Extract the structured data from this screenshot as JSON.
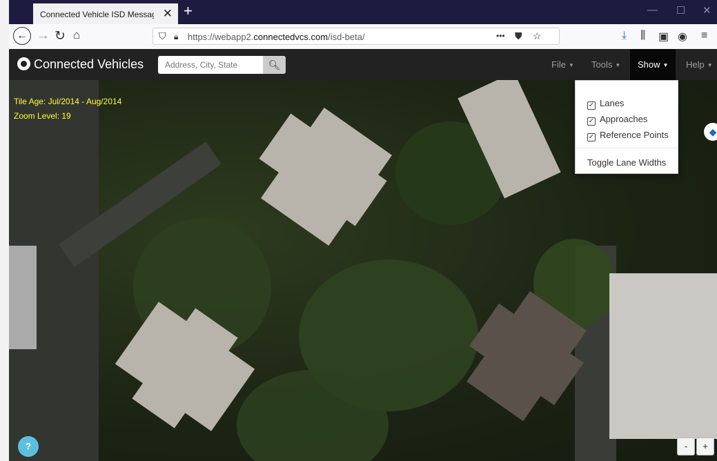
{
  "browser": {
    "tab_title": "Connected Vehicle ISD Message Cre",
    "tab_close": "✕",
    "new_tab": "+",
    "window_controls": [
      "—",
      "☐",
      "✕"
    ],
    "url_prefix": "https://webapp2.",
    "url_domain": "connectedvcs.com",
    "url_path": "/isd-beta/",
    "url_more": "•••"
  },
  "app": {
    "brand": "Connected Vehicles",
    "search": {
      "placeholder": "Address, City, State"
    },
    "menus": {
      "file": "File",
      "tools": "Tools",
      "show": "Show",
      "help": "Help"
    }
  },
  "map": {
    "tile_age": "Tile Age: Jul/2014 - Aug/2014",
    "zoom_level": "Zoom Level: 19",
    "help_label": "?",
    "zoom_out": "-",
    "zoom_in": "+"
  },
  "show_menu": {
    "items": [
      {
        "label": "Lanes",
        "checked": true
      },
      {
        "label": "Approaches",
        "checked": true
      },
      {
        "label": "Reference Points",
        "checked": true
      }
    ],
    "toggle_label": "Toggle Lane Widths"
  },
  "colors": {
    "tab_bar": "#1e1b40",
    "app_bar": "#222222",
    "map_text": "#ffff33",
    "help_button": "#5bc0de"
  }
}
